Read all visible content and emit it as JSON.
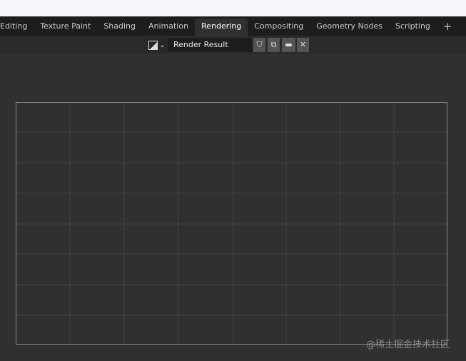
{
  "workspace_tabs": [
    "Editing",
    "Texture Paint",
    "Shading",
    "Animation",
    "Rendering",
    "Compositing",
    "Geometry Nodes",
    "Scripting"
  ],
  "active_tab": "Rendering",
  "add_tab": "+",
  "image_editor": {
    "image_name": "Render Result",
    "icons": [
      "image-icon",
      "chevron-down-icon",
      "fake-user-shield-icon",
      "duplicate-icon",
      "open-folder-icon",
      "close-icon"
    ]
  },
  "watermark": "@稀土掘金技术社区",
  "colors": {
    "tab_bar": "#1d1d1d",
    "active_tab": "#303030",
    "viewport": "#303030"
  }
}
